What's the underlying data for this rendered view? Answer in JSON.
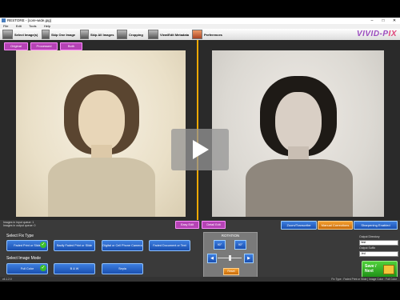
{
  "window": {
    "title": "RESTORE - [core-wide.jpg]",
    "minimize": "–",
    "maximize": "□",
    "close": "✕"
  },
  "menu": [
    "File",
    "Edit",
    "Tools",
    "Help"
  ],
  "toolbar": {
    "items": [
      "Select Image(s)",
      "Skip One Image",
      "Skip All Images",
      "Cropping",
      "View/Edit Metadata",
      "Preferences"
    ],
    "logo_main": "VIVID-P",
    "logo_accent": "IX"
  },
  "view_buttons": [
    "Original",
    "Processed",
    "Both"
  ],
  "queue": {
    "line1": "Images in input queue: 1",
    "line2": "Images in output queue: 0"
  },
  "edit_buttons": [
    "Easy Edit",
    "Detail Edit"
  ],
  "options": {
    "zoom": "Zoom/Transcribe",
    "manual": "Manual Corrections",
    "sharpen": "Sharpening Enabled"
  },
  "fix_type": {
    "label": "Select Fix Type",
    "buttons": [
      "Faded Print or Slide",
      "Badly Faded Print or Slide",
      "Digital or Cell Phone Camera",
      "Faded Document or Text"
    ]
  },
  "image_mode": {
    "label": "Select Image Mode",
    "buttons": [
      "Full Color",
      "B & W",
      "Sepia"
    ]
  },
  "rotation": {
    "label": "ROTATION",
    "ccw": "90°",
    "cw": "90°",
    "left": "◀",
    "right": "▶",
    "reset": "Reset"
  },
  "output": {
    "dir_label": "Output Directory",
    "dir_value": "/test",
    "suffix_label": "Output Suffix",
    "suffix_value": "-fed",
    "save": "Save / Next"
  },
  "status": {
    "version": "v4.1.2.0",
    "right": "Fix Type : Faded Print or Slide | Image Color : Full Color"
  },
  "colors": {
    "accent_purple": "#b543b5",
    "blue_button": "#2a62c9",
    "green_check": "#3bbf2a",
    "orange_divider": "#f0a800"
  }
}
